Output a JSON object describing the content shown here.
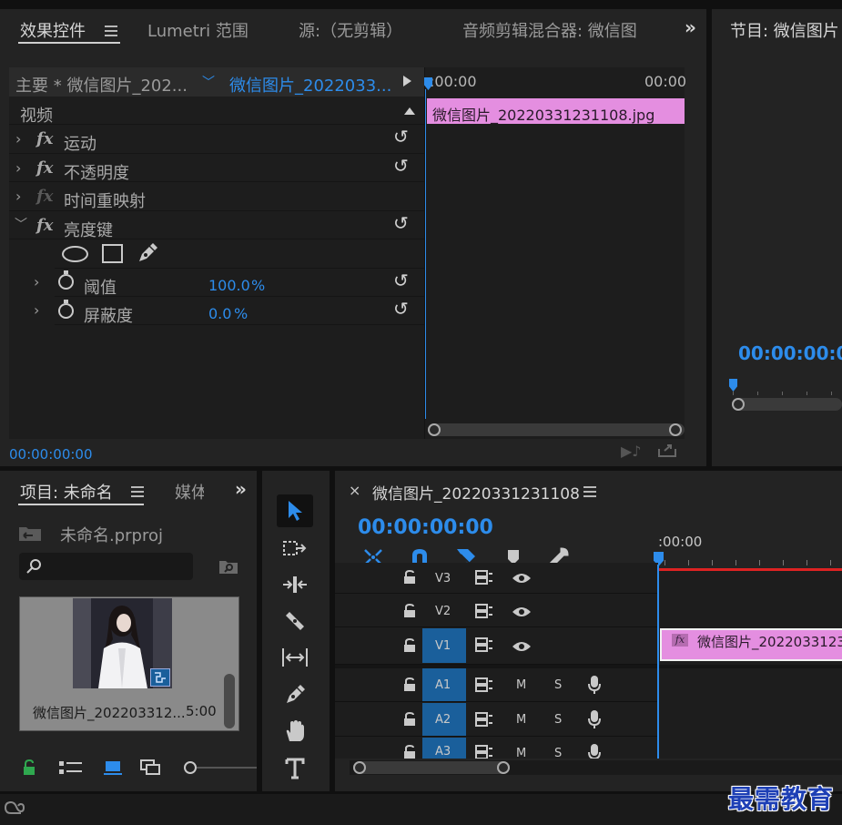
{
  "effect_controls": {
    "tabs": [
      {
        "label": "效果控件"
      },
      {
        "label": "Lumetri 范围"
      },
      {
        "label": "源:（无剪辑）"
      },
      {
        "label": "音频剪辑混合器: 微信图"
      }
    ],
    "more": "»",
    "master_label": "主要 * 微信图片_202...",
    "clip_label": "微信图片_2022033...",
    "section_label": "视频",
    "effects": [
      {
        "label": "运动"
      },
      {
        "label": "不透明度"
      },
      {
        "label": "时间重映射"
      },
      {
        "label": "亮度键"
      }
    ],
    "params": [
      {
        "label": "阈值",
        "value": "100.0",
        "unit": "%"
      },
      {
        "label": "屏蔽度",
        "value": "0.0",
        "unit": "%"
      }
    ],
    "timecode": "00:00:00:00",
    "ruler_start": ":00:00",
    "ruler_end": "00:00",
    "clip_name": "微信图片_20220331231108.jpg"
  },
  "program": {
    "title": "节目: 微信图片",
    "timecode": "00:00:00:00"
  },
  "project": {
    "title": "项目: 未命名",
    "second_tab": "媒体",
    "file": "未命名.prproj",
    "search_placeholder": "",
    "item_name": "微信图片_20220331231108",
    "item_name_display": "微信图片_202203312...",
    "item_duration": "5:00"
  },
  "timeline": {
    "title": "微信图片_20220331231108",
    "timecode": "00:00:00:00",
    "ruler_label": ":00:00",
    "tracks": [
      {
        "name": "V3",
        "type": "video"
      },
      {
        "name": "V2",
        "type": "video"
      },
      {
        "name": "V1",
        "type": "video"
      },
      {
        "name": "A1",
        "type": "audio"
      },
      {
        "name": "A2",
        "type": "audio"
      },
      {
        "name": "A3",
        "type": "audio"
      }
    ],
    "mute_label": "M",
    "solo_label": "S",
    "clip_name": "微信图片_20220331231"
  },
  "watermark": "最需教育",
  "colors": {
    "accent": "#2d8ceb",
    "clip_pink": "#e48ee0",
    "track_blue": "#1a5f9b",
    "panel": "#232323"
  }
}
